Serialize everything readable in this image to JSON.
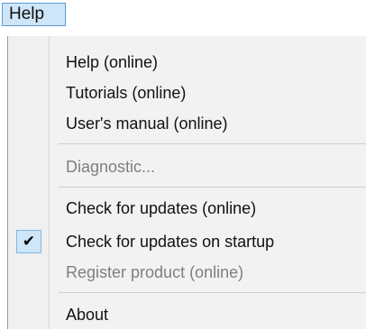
{
  "menubar": {
    "title": "Help"
  },
  "menu": {
    "items": [
      {
        "label": "Help (online)",
        "enabled": true
      },
      {
        "label": "Tutorials (online)",
        "enabled": true
      },
      {
        "label": "User's manual (online)",
        "enabled": true
      },
      {
        "label": "Diagnostic...",
        "enabled": false
      },
      {
        "label": "Check for updates (online)",
        "enabled": true
      },
      {
        "label": "Check for updates on startup",
        "enabled": true,
        "checked": true,
        "check_glyph": "✔"
      },
      {
        "label": "Register product (online)",
        "enabled": false
      },
      {
        "label": "About",
        "enabled": true
      }
    ]
  },
  "colors": {
    "highlight": "#cfe6f8",
    "highlight_border": "#5a9bd6",
    "menu_background": "#f2f2f2",
    "disabled_text": "#7f7f7f"
  },
  "icons": {
    "checked": "check-mark-icon"
  }
}
